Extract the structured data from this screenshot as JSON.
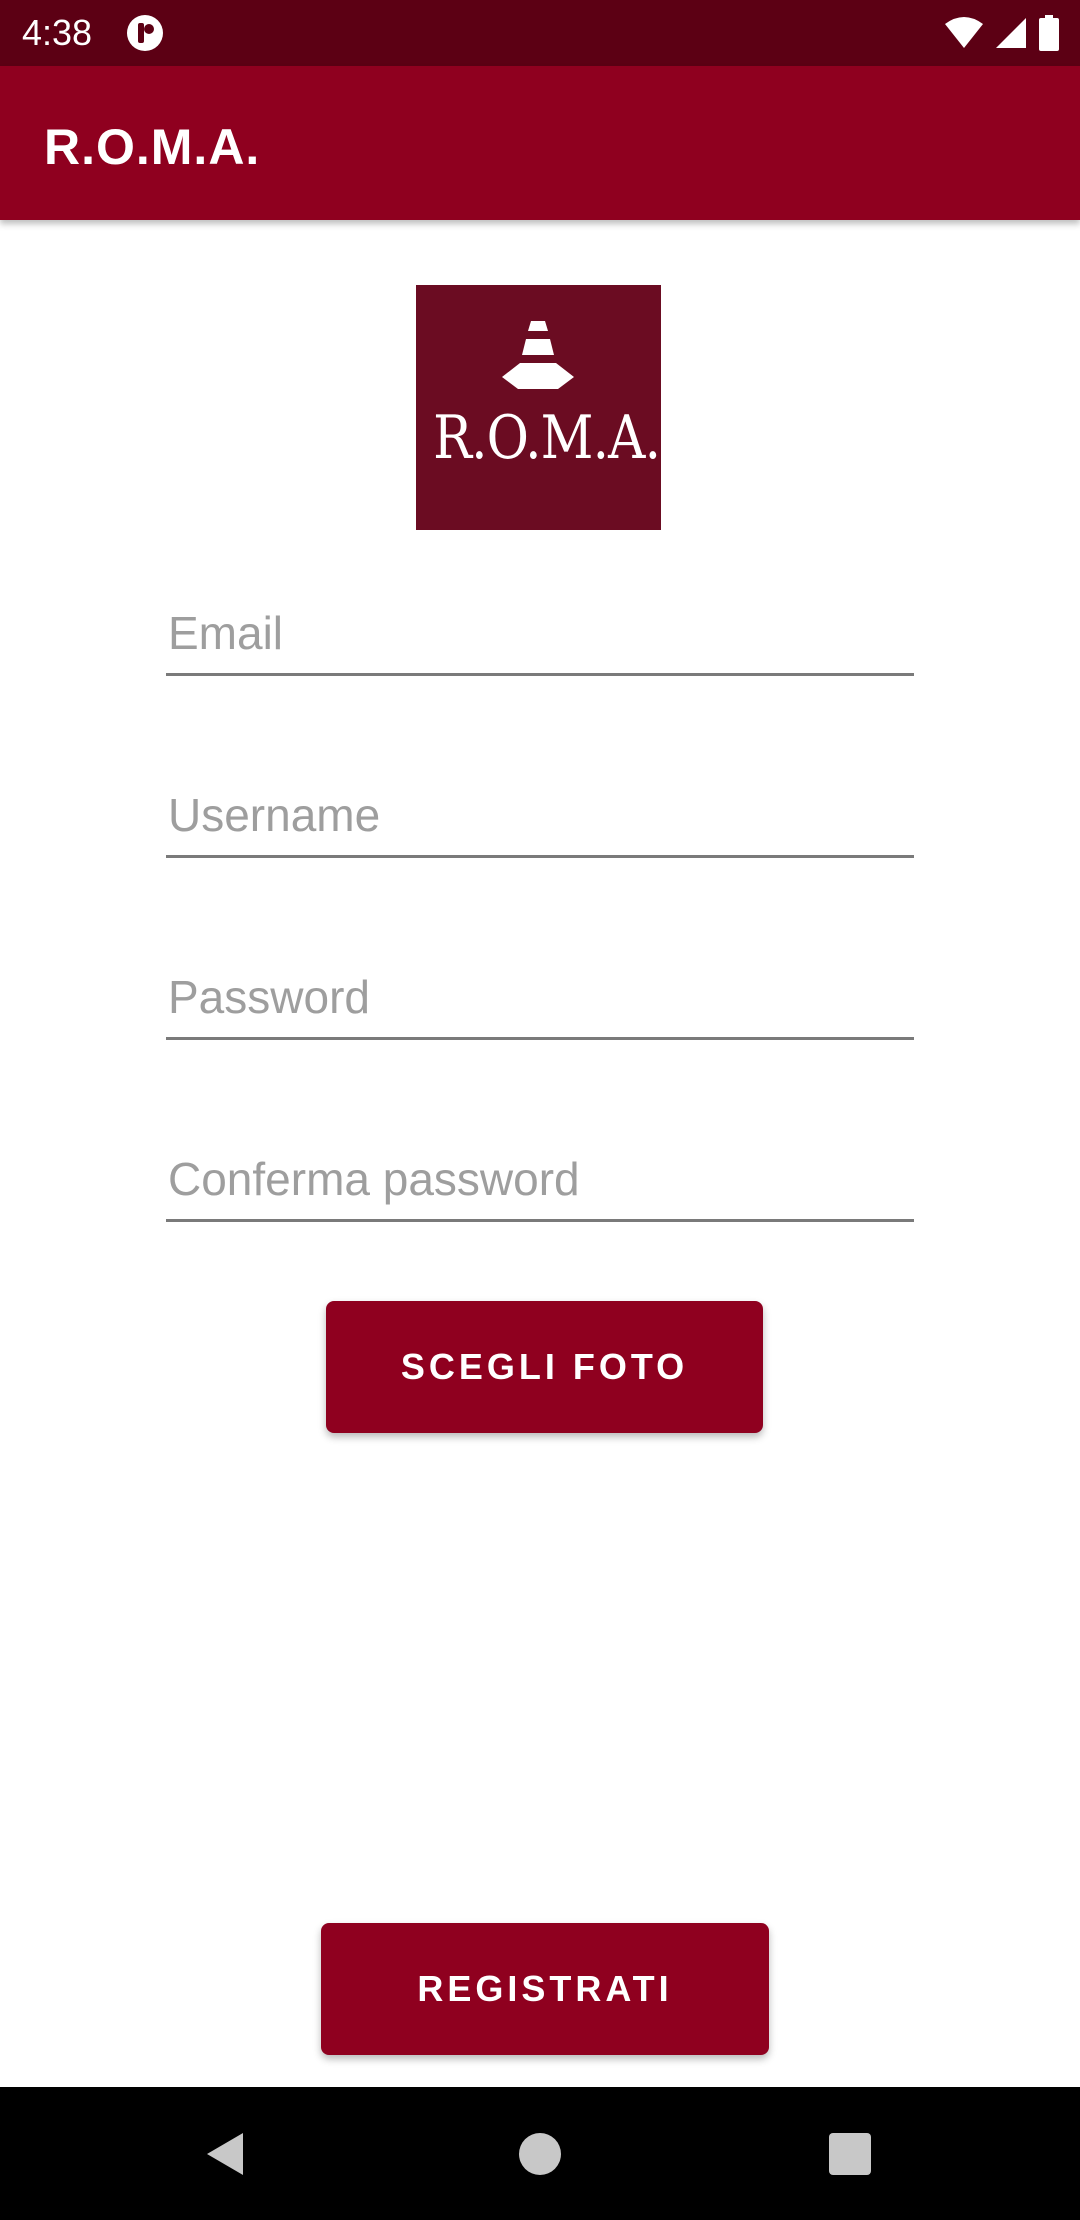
{
  "status_bar": {
    "time": "4:38",
    "icons": [
      "notification-icon",
      "wifi-icon",
      "signal-icon",
      "battery-icon"
    ]
  },
  "app_bar": {
    "title": "R.O.M.A."
  },
  "logo": {
    "text": "R.O.M.A.",
    "icon": "traffic-cone-icon"
  },
  "form": {
    "email_placeholder": "Email",
    "username_placeholder": "Username",
    "password_placeholder": "Password",
    "confirm_password_placeholder": "Conferma password"
  },
  "buttons": {
    "choose_photo": "SCEGLI FOTO",
    "register": "REGISTRATI"
  },
  "nav_bar": {
    "icons": [
      "back-icon",
      "home-icon",
      "recents-icon"
    ]
  },
  "colors": {
    "primary": "#8f001f",
    "primary_dark": "#5c0014",
    "logo_background": "#6b0c22"
  }
}
